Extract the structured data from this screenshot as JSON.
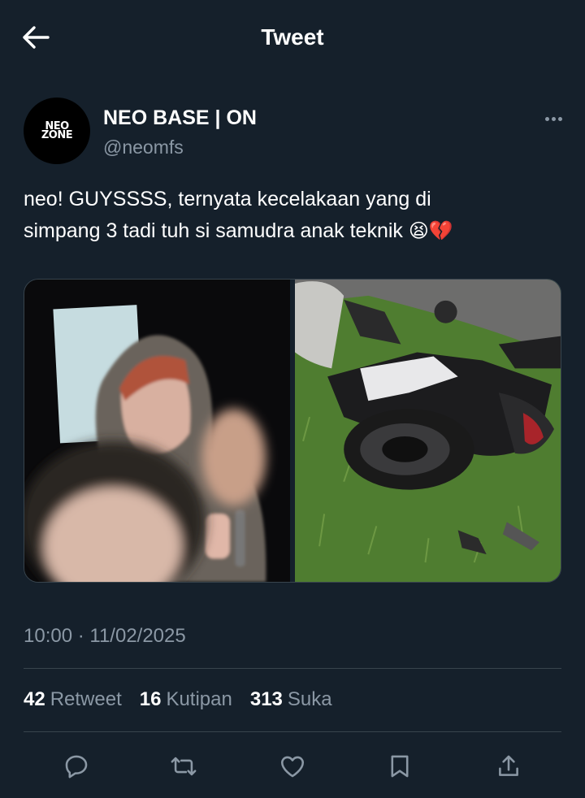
{
  "header": {
    "title": "Tweet",
    "back_icon": "arrow-left-icon"
  },
  "author": {
    "avatar_logo_line1": "NEO",
    "avatar_logo_line2": "ZONE",
    "display_name": "NEO BASE | ON",
    "handle": "@neomfs"
  },
  "tweet": {
    "text_line1": "neo! GUYSSSS, ternyata kecelakaan yang di",
    "text_line2": "simpang 3 tadi tuh si samudra anak teknik ",
    "emoji_1": "😫",
    "emoji_2": "💔",
    "timestamp": "10:00 · 11/02/2025"
  },
  "stats": {
    "retweets_count": "42",
    "retweets_label": "Retweet",
    "quotes_count": "16",
    "quotes_label": "Kutipan",
    "likes_count": "313",
    "likes_label": "Suka"
  },
  "actions": [
    "reply-icon",
    "retweet-icon",
    "like-icon",
    "bookmark-icon",
    "share-icon"
  ],
  "colors": {
    "background": "#15202b",
    "muted": "#8b98a5",
    "divider": "#38444d",
    "text": "#ffffff"
  }
}
